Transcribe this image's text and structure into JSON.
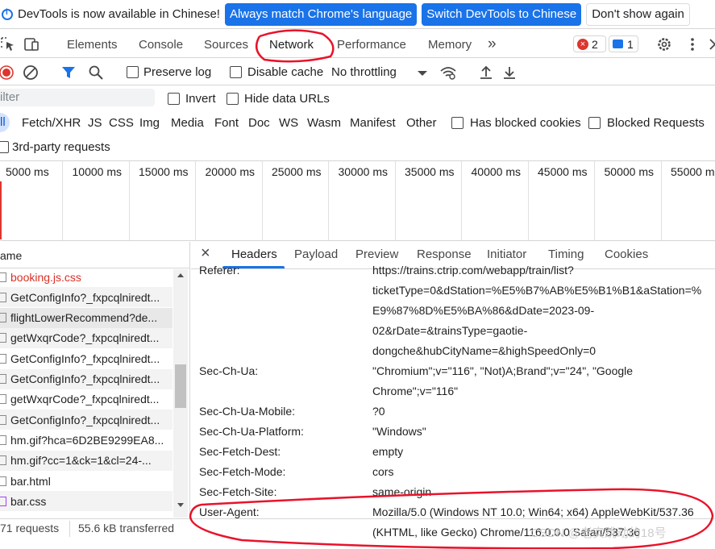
{
  "banner": {
    "message": "DevTools is now available in Chinese!",
    "btn_match": "Always match Chrome's language",
    "btn_switch": "Switch DevTools to Chinese",
    "btn_dismiss": "Don't show again"
  },
  "tabs": {
    "elements": "Elements",
    "console": "Console",
    "sources": "Sources",
    "network": "Network",
    "performance": "Performance",
    "memory": "Memory",
    "more": "»",
    "errors_count": "2",
    "messages_count": "1"
  },
  "toolbar": {
    "preserve_log": "Preserve log",
    "disable_cache": "Disable cache",
    "throttling": "No throttling"
  },
  "filter": {
    "placeholder": "ilter",
    "invert": "Invert",
    "hide_data_urls": "Hide data URLs"
  },
  "types": {
    "all": "ll",
    "fetch": "Fetch/XHR",
    "js": "JS",
    "css": "CSS",
    "img": "Img",
    "media": "Media",
    "font": "Font",
    "doc": "Doc",
    "ws": "WS",
    "wasm": "Wasm",
    "manifest": "Manifest",
    "other": "Other",
    "blocked_cookies": "Has blocked cookies",
    "blocked_requests": "Blocked Requests",
    "third_party": "3rd-party requests"
  },
  "timeline": {
    "ticks": [
      "5000 ms",
      "10000 ms",
      "15000 ms",
      "20000 ms",
      "25000 ms",
      "30000 ms",
      "35000 ms",
      "40000 ms",
      "45000 ms",
      "50000 ms",
      "55000 m"
    ]
  },
  "requests": {
    "header": "ame",
    "rows": [
      {
        "name": "booking.js.css",
        "color": "#d93025"
      },
      {
        "name": "GetConfigInfo?_fxpcqlniredt..."
      },
      {
        "name": "flightLowerRecommend?de..."
      },
      {
        "name": "getWxqrCode?_fxpcqlniredt..."
      },
      {
        "name": "GetConfigInfo?_fxpcqlniredt..."
      },
      {
        "name": "GetConfigInfo?_fxpcqlniredt..."
      },
      {
        "name": "getWxqrCode?_fxpcqlniredt..."
      },
      {
        "name": "GetConfigInfo?_fxpcqlniredt..."
      },
      {
        "name": "hm.gif?hca=6D2BE9299EA8..."
      },
      {
        "name": "hm.gif?cc=1&ck=1&cl=24-..."
      },
      {
        "name": "bar.html"
      },
      {
        "name": "bar.css"
      }
    ]
  },
  "status": {
    "requests": "71 requests",
    "transferred": "55.6 kB transferred"
  },
  "details": {
    "close": "×",
    "tabs": [
      "Headers",
      "Payload",
      "Preview",
      "Response",
      "Initiator",
      "Timing",
      "Cookies"
    ],
    "headers": [
      {
        "name": "Referer:",
        "lines": [
          "https://trains.ctrip.com/webapp/train/list?",
          "ticketType=0&dStation=%E5%B7%AB%E5%B1%B1&aStation=%",
          "E9%87%8D%E5%BA%86&dDate=2023-09-",
          "02&rDate=&trainsType=gaotie-",
          "dongche&hubCityName=&highSpeedOnly=0"
        ]
      },
      {
        "name": "Sec-Ch-Ua:",
        "lines": [
          "\"Chromium\";v=\"116\", \"Not)A;Brand\";v=\"24\", \"Google",
          "Chrome\";v=\"116\""
        ]
      },
      {
        "name": "Sec-Ch-Ua-Mobile:",
        "lines": [
          "?0"
        ]
      },
      {
        "name": "Sec-Ch-Ua-Platform:",
        "lines": [
          "\"Windows\""
        ]
      },
      {
        "name": "Sec-Fetch-Dest:",
        "lines": [
          "empty"
        ]
      },
      {
        "name": "Sec-Fetch-Mode:",
        "lines": [
          "cors"
        ]
      },
      {
        "name": "Sec-Fetch-Site:",
        "lines": [
          "same-origin"
        ]
      },
      {
        "name": "User-Agent:",
        "lines": [
          "Mozilla/5.0 (Windows NT 10.0; Win64; x64) AppleWebKit/537.36",
          "(KHTML, like Gecko) Chrome/116.0.0.0 Safari/537.36"
        ]
      }
    ]
  },
  "watermark": "CSDN @老实跳动的18号",
  "colors": {
    "accent": "#1a73e8",
    "annotation": "#e8132a",
    "error": "#dc362e"
  }
}
